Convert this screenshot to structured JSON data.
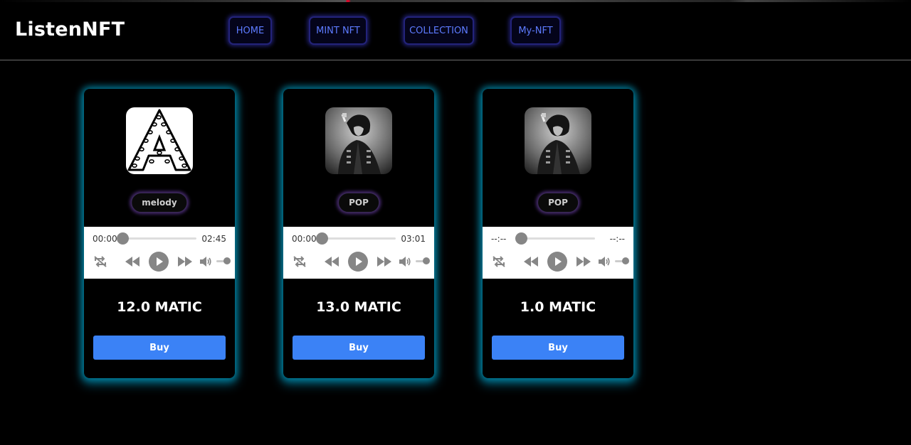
{
  "app": {
    "brand": "ListenNFT"
  },
  "nav": [
    {
      "id": "home",
      "label": "HOME"
    },
    {
      "id": "mint",
      "label": "MINT NFT"
    },
    {
      "id": "collection",
      "label": "COLLECTION"
    },
    {
      "id": "mynft",
      "label": "My-NFT"
    }
  ],
  "cards": [
    {
      "genre": "melody",
      "current_time": "00:00",
      "duration": "02:45",
      "price": "12.0 MATIC",
      "buy_label": "Buy",
      "artwork": "letter-a-pattern-image"
    },
    {
      "genre": "POP",
      "current_time": "00:00",
      "duration": "03:01",
      "price": "13.0 MATIC",
      "buy_label": "Buy",
      "artwork": "singer-photo-image"
    },
    {
      "genre": "POP",
      "current_time": "--:--",
      "duration": "--:--",
      "price": "1.0 MATIC",
      "buy_label": "Buy",
      "artwork": "singer-photo-image"
    }
  ],
  "icons": {
    "loop": "repeat-off-icon",
    "rewind": "rewind-icon",
    "play": "play-icon",
    "forward": "fast-forward-icon",
    "volume": "volume-icon"
  },
  "colors": {
    "nav_text": "#5d7bff",
    "card_glow": "#00aad2",
    "buy_button": "#3b82f6",
    "genre_glow": "#7846be"
  }
}
